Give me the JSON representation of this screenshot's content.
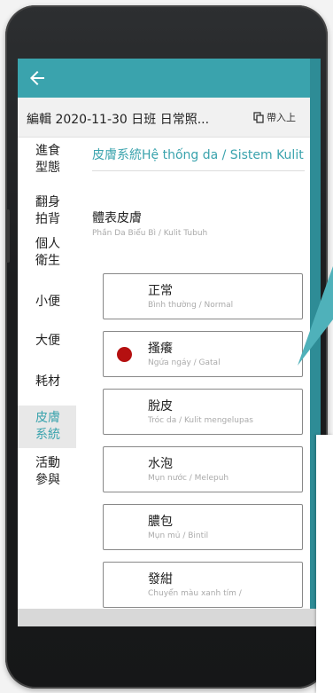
{
  "header": {
    "title": "編輯 2020-11-30 日班 日常照...",
    "import_label": "帶入上"
  },
  "sidebar": {
    "items": [
      {
        "label": "進食型態"
      },
      {
        "label": "翻身拍背"
      },
      {
        "label": "個人衛生"
      },
      {
        "label": "小便"
      },
      {
        "label": "大便"
      },
      {
        "label": "耗材"
      },
      {
        "label": "皮膚系統",
        "active": true
      },
      {
        "label": "活動參與"
      }
    ]
  },
  "section": {
    "title": "皮膚系統Hệ thống da / Sistem Kulit"
  },
  "field": {
    "title": "體表皮膚",
    "subtitle": "Phần Da Biểu Bì / Kulit Tubuh"
  },
  "options": [
    {
      "label": "正常",
      "sub": "Bình thường / Normal",
      "selected": false
    },
    {
      "label": "搔癢",
      "sub": "Ngứa ngáy / Gatal",
      "selected": true
    },
    {
      "label": "脫皮",
      "sub": "Tróc da / Kulit mengelupas",
      "selected": false
    },
    {
      "label": "水泡",
      "sub": "Mụn nước / Melepuh",
      "selected": false
    },
    {
      "label": "膿包",
      "sub": "Mụn mủ / Bintil",
      "selected": false
    },
    {
      "label": "發紺",
      "sub": "Chuyển màu xanh tím /",
      "selected": false
    }
  ],
  "colors": {
    "appbar": "#3aa3ad",
    "accent": "#3aa3ad",
    "selected_dot": "#b51010"
  },
  "icons": {
    "back": "back-arrow-icon",
    "import": "copy-icon"
  }
}
